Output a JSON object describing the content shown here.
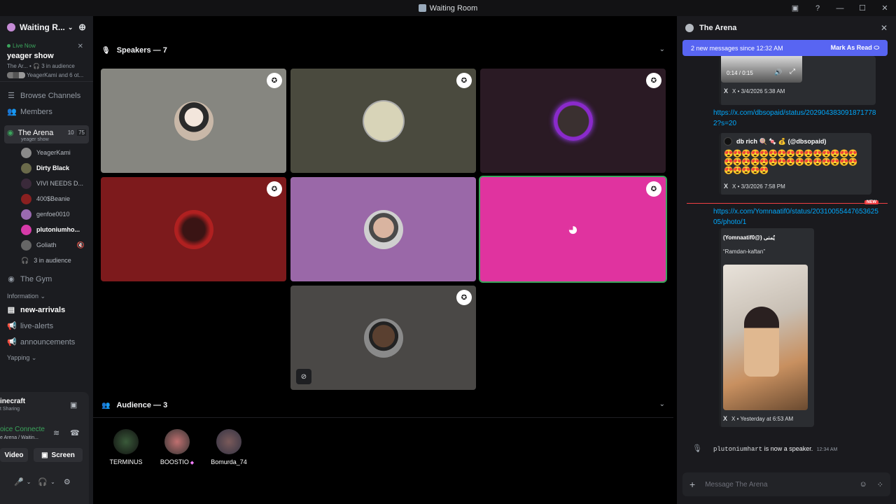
{
  "window": {
    "title": "Waiting Room"
  },
  "sidebar": {
    "server_name": "Waiting R...",
    "live": {
      "badge": "Live Now",
      "title": "yeager show",
      "channel": "The Ar...",
      "audience": "3 in audience",
      "members": "YeagerKami and 6 ot..."
    },
    "nav": [
      {
        "icon": "browse-icon",
        "label": "Browse Channels"
      },
      {
        "icon": "members-icon",
        "label": "Members"
      }
    ],
    "active_channel": {
      "name": "The Arena",
      "sub": "yeager show",
      "count_a": "10",
      "count_b": "75"
    },
    "members": [
      "YeagerKami",
      "Dirty Black",
      "VIVI NEEDS D...",
      "400$Beanie",
      "genfoe0010",
      "plutoniumho...",
      "Goliath"
    ],
    "audience_line": "3 in audience",
    "other_channel": "The Gym",
    "section": "Information",
    "text_channels": [
      "new-arrivals",
      "live-alerts",
      "announcements"
    ],
    "next_section": "Yapping",
    "activity": {
      "title": "inecraft",
      "sub": "t Sharing"
    },
    "voice": {
      "status": "oice Connecte",
      "location": "e Arena / Waitin..."
    },
    "buttons": {
      "video": "Video",
      "screen": "Screen"
    }
  },
  "stage": {
    "speakers_header": "Speakers — 7",
    "audience_header": "Audience — 3",
    "audience": [
      {
        "name": "TERMINUS"
      },
      {
        "name": "BOOSTIO"
      },
      {
        "name": "Bomurda_74"
      }
    ]
  },
  "chat": {
    "title": "The Arena",
    "banner": {
      "text": "2 new messages since 12:32 AM",
      "action": "Mark As Read"
    },
    "video_time": "0:14 / 0:15",
    "embed1_src": "X • 3/4/2026 5:38 AM",
    "link1": "https://x.com/dbsopaid/status/2029043830918717782?s=20",
    "embed2_author": "db rich 🍭 🍬 💰 (@dbsopaid)",
    "embed2_src": "X • 3/3/2026 7:58 PM",
    "new_label": "NEW",
    "link2": "https://x.com/Yomnaatif0/status/2031005544765362505/photo/1",
    "embed3_author": "(Yomnaatif0@) يُمنى",
    "embed3_text": "“Ramdan-kaftan”",
    "embed3_src": "X • Yesterday at 6:53 AM",
    "system_user": "plutoniumhart",
    "system_text": " is now a speaker.",
    "system_time": "12:34 AM",
    "input_placeholder": "Message The Arena"
  },
  "colors": {
    "accent": "#5865f2",
    "live": "#3ba55c",
    "link": "#00a8fc",
    "new": "#f23f43"
  }
}
